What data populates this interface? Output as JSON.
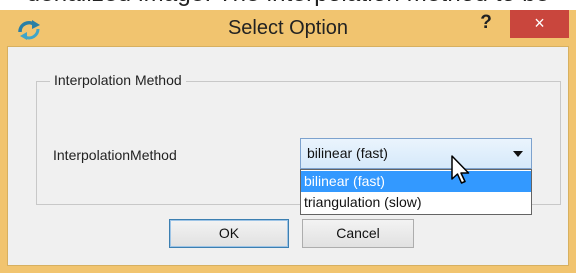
{
  "background_text": "denalized image. The interpolation method to be",
  "window": {
    "title": "Select Option",
    "help_label": "?",
    "close_label": "×"
  },
  "group": {
    "legend": "Interpolation Method"
  },
  "field": {
    "label": "InterpolationMethod",
    "selected_value": "bilinear (fast)",
    "options": [
      "bilinear (fast)",
      "triangulation (slow)"
    ],
    "highlighted_option": "bilinear (fast)"
  },
  "buttons": {
    "ok_label": "OK",
    "cancel_label": "Cancel"
  },
  "icons": {
    "app": "refresh-arrows-icon",
    "combo_arrow": "chevron-down-icon",
    "cursor": "mouse-pointer-icon"
  },
  "colors": {
    "frame": "#f1c46f",
    "close": "#c9463d",
    "highlight": "#3399ff"
  }
}
